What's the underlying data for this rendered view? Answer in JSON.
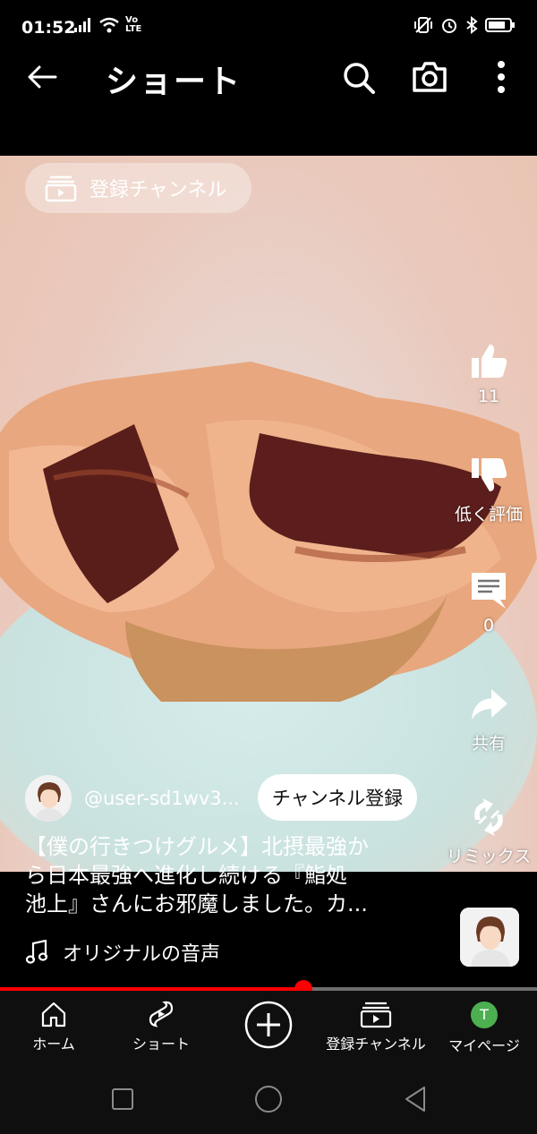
{
  "status_bar": {
    "time": "01:52",
    "signal_icon": "signal-bars-icon",
    "wifi_icon": "wifi-icon",
    "volte_label": "Vo LTE",
    "right_icons": [
      "vibrate-icon",
      "alarm-icon",
      "bluetooth-icon",
      "battery-icon"
    ]
  },
  "app_bar": {
    "title": "ショート",
    "back_icon": "arrow-left-icon",
    "search_icon": "search-icon",
    "camera_icon": "camera-icon",
    "more_icon": "more-vertical-icon"
  },
  "video": {
    "subscriptions_chip": "登録チャンネル",
    "actions": {
      "like_count": "11",
      "dislike_label": "低く評価",
      "comment_count": "0",
      "share_label": "共有",
      "remix_label": "リミックス"
    },
    "channel": {
      "handle": "@user-sd1wv3...",
      "subscribe_label": "チャンネル登録"
    },
    "title_line1": "【僕の行きつけグルメ】北摂最強か",
    "title_line2": "ら日本最強へ進化し続ける『鮨処",
    "title_line3": "池上』さんにお邪魔しました。カ...",
    "sound_label": "オリジナルの音声",
    "progress_fraction": 0.565
  },
  "bottom_nav": {
    "home": "ホーム",
    "shorts": "ショート",
    "create_icon": "plus-circle-icon",
    "subscriptions": "登録チャンネル",
    "you": "マイページ",
    "you_avatar_letter": "T"
  },
  "colors": {
    "accent_red": "#ff0000",
    "avatar_green": "#4caf50",
    "background": "#000000"
  }
}
